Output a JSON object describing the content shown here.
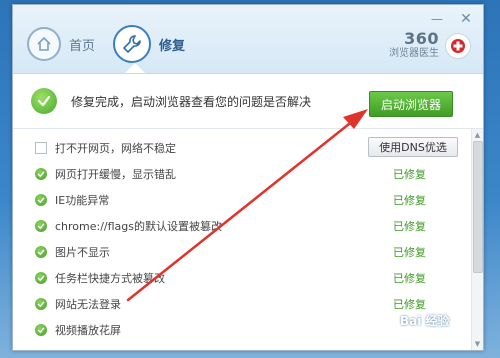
{
  "header": {
    "nav": {
      "home_label": "首页",
      "repair_label": "修复"
    },
    "brand": {
      "name": "360",
      "subtitle": "浏览器医生"
    }
  },
  "status": {
    "message": "修复完成，启动浏览器查看您的问题是否解决",
    "launch_button": "启动浏览器"
  },
  "list": {
    "items": [
      {
        "label": "打不开网页，网络不稳定",
        "state": "unchecked",
        "action": "使用DNS优选"
      },
      {
        "label": "网页打开缓慢，显示错乱",
        "status": "已修复"
      },
      {
        "label": "IE功能异常",
        "status": "已修复"
      },
      {
        "label": "chrome://flags的默认设置被篡改",
        "status": "已修复"
      },
      {
        "label": "图片不显示",
        "status": "已修复"
      },
      {
        "label": "任务栏快捷方式被篡改",
        "status": "已修复"
      },
      {
        "label": "网站无法登录",
        "status": "已修复"
      },
      {
        "label": "视频播放花屏",
        "status": ""
      }
    ]
  },
  "watermark": {
    "text": "Bai 经验"
  },
  "colors": {
    "accent_green": "#3f9d24",
    "status_green": "#3d9a22",
    "arrow_red": "#e0332b",
    "brand_red": "#d9262b"
  }
}
